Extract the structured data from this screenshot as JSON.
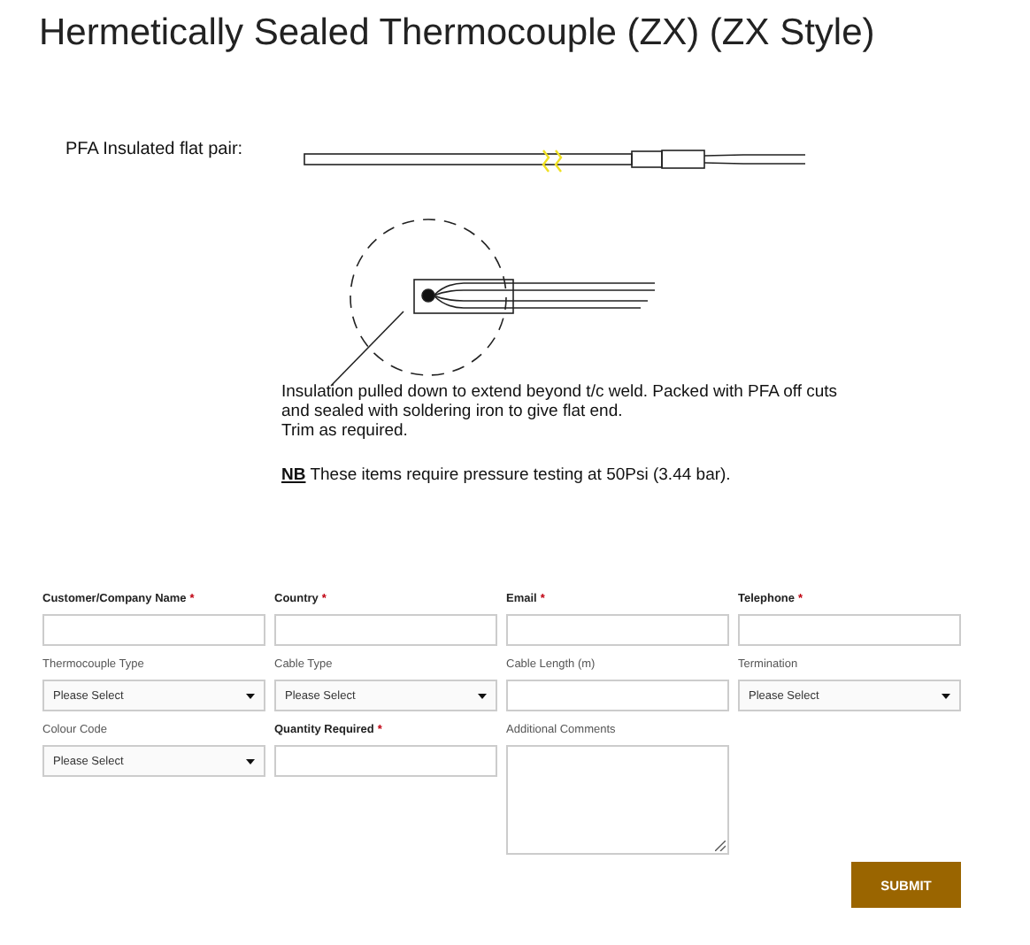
{
  "title": "Hermetically Sealed Thermocouple (ZX) (ZX Style)",
  "diagram": {
    "label": "PFA Insulated flat pair:",
    "note_lines": [
      "Insulation pulled down to extend beyond t/c weld. Packed with PFA off cuts",
      "and sealed with soldering iron to give flat end.",
      "Trim as required."
    ],
    "notice": "**NB** These items require pressure testing at 50Psi (3.44 bar)."
  },
  "form": {
    "fields": [
      {
        "label": "Customer/Company Name",
        "required": true,
        "kind": "text"
      },
      {
        "label": "Country",
        "required": true,
        "kind": "text"
      },
      {
        "label": "Email",
        "required": true,
        "kind": "text"
      },
      {
        "label": "Telephone",
        "required": true,
        "kind": "text"
      },
      {
        "label": "Thermocouple Type",
        "required": false,
        "kind": "select",
        "value": "Please Select"
      },
      {
        "label": "Cable Type",
        "required": false,
        "kind": "select",
        "value": "Please Select"
      },
      {
        "label": "Cable Length (m)",
        "required": false,
        "kind": "text"
      },
      {
        "label": "Termination",
        "required": false,
        "kind": "select",
        "value": "Please Select"
      },
      {
        "label": "Colour Code",
        "required": false,
        "kind": "select",
        "value": "Please Select"
      },
      {
        "label": "Quantity Required",
        "required": true,
        "kind": "text"
      },
      {
        "label": "Additional Comments",
        "required": false,
        "kind": "textarea"
      }
    ],
    "required_mark": "*",
    "submit": "SUBMIT"
  }
}
